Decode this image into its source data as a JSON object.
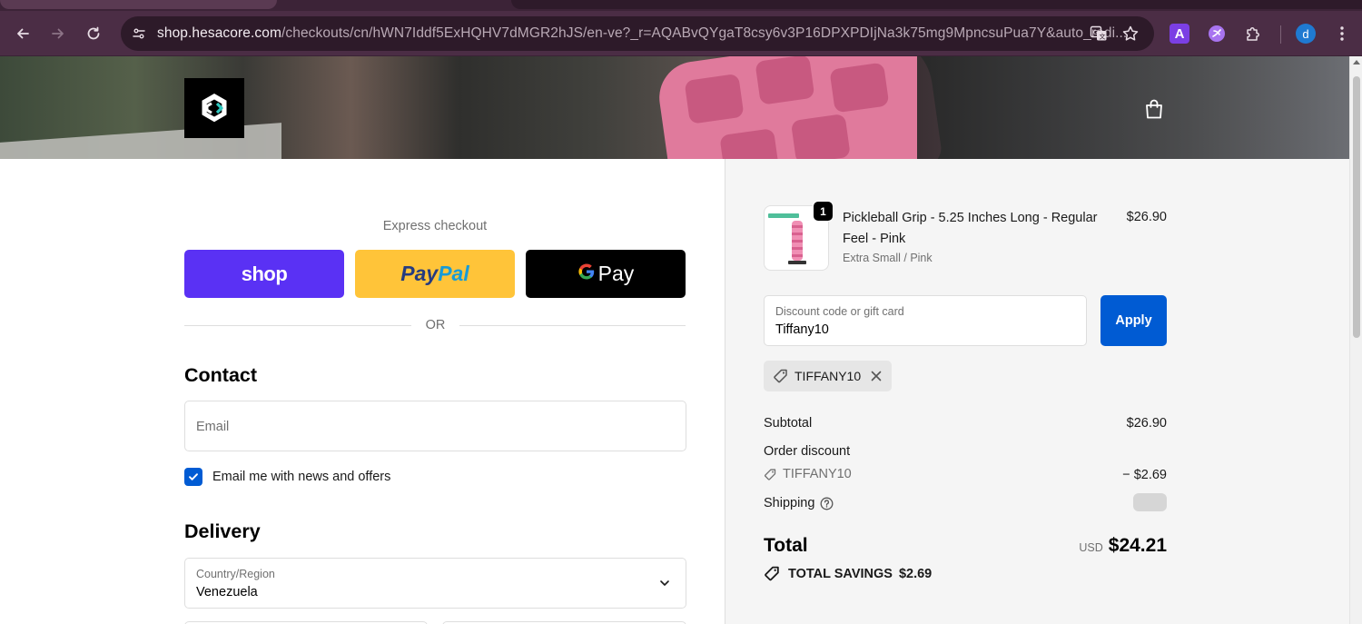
{
  "browser": {
    "url_host": "shop.hesacore.com",
    "url_path": "/checkouts/cn/hWN7Iddf5ExHQHV7dMGR2hJS/en-ve?_r=AQABvQYgaT8csy6v3P16DPXPDIjNa3k75mg9MpncsuPua7Y&auto_redi...",
    "extension_letter": "A",
    "profile_initial": "d",
    "icons": [
      "back-icon",
      "forward-icon",
      "reload-icon",
      "site-info-icon",
      "translate-icon",
      "bookmark-star-icon",
      "extensions-icon",
      "menu-icon"
    ]
  },
  "header": {
    "logo_icon": "hesacore-logo",
    "cart_icon": "shopping-bag-icon"
  },
  "express": {
    "label": "Express checkout",
    "shop_label": "shop",
    "paypal_part1": "Pay",
    "paypal_part2": "Pal",
    "gpay_g": "G",
    "gpay_label": "Pay",
    "or": "OR"
  },
  "contact": {
    "title": "Contact",
    "email_placeholder": "Email",
    "newsletter_label": "Email me with news and offers",
    "newsletter_checked": true
  },
  "delivery": {
    "title": "Delivery",
    "country_label": "Country/Region",
    "country_value": "Venezuela"
  },
  "summary": {
    "product": {
      "quantity": "1",
      "name": "Pickleball Grip - 5.25 Inches Long - Regular Feel - Pink",
      "variant": "Extra Small / Pink",
      "price": "$26.90"
    },
    "discount": {
      "label": "Discount code or gift card",
      "value": "Tiffany10",
      "apply_label": "Apply",
      "applied_code": "TIFFANY10"
    },
    "lines": {
      "subtotal_label": "Subtotal",
      "subtotal_value": "$26.90",
      "order_discount_label": "Order discount",
      "discount_code": "TIFFANY10",
      "discount_value": "− $2.69",
      "shipping_label": "Shipping"
    },
    "total": {
      "label": "Total",
      "currency": "USD",
      "amount": "$24.21",
      "savings_label": "TOTAL SAVINGS",
      "savings_amount": "$2.69"
    }
  },
  "colors": {
    "shop_purple": "#5a31f4",
    "paypal_yellow": "#ffc439",
    "apply_blue": "#005bd3",
    "chrome_bg": "#4b2d45"
  }
}
